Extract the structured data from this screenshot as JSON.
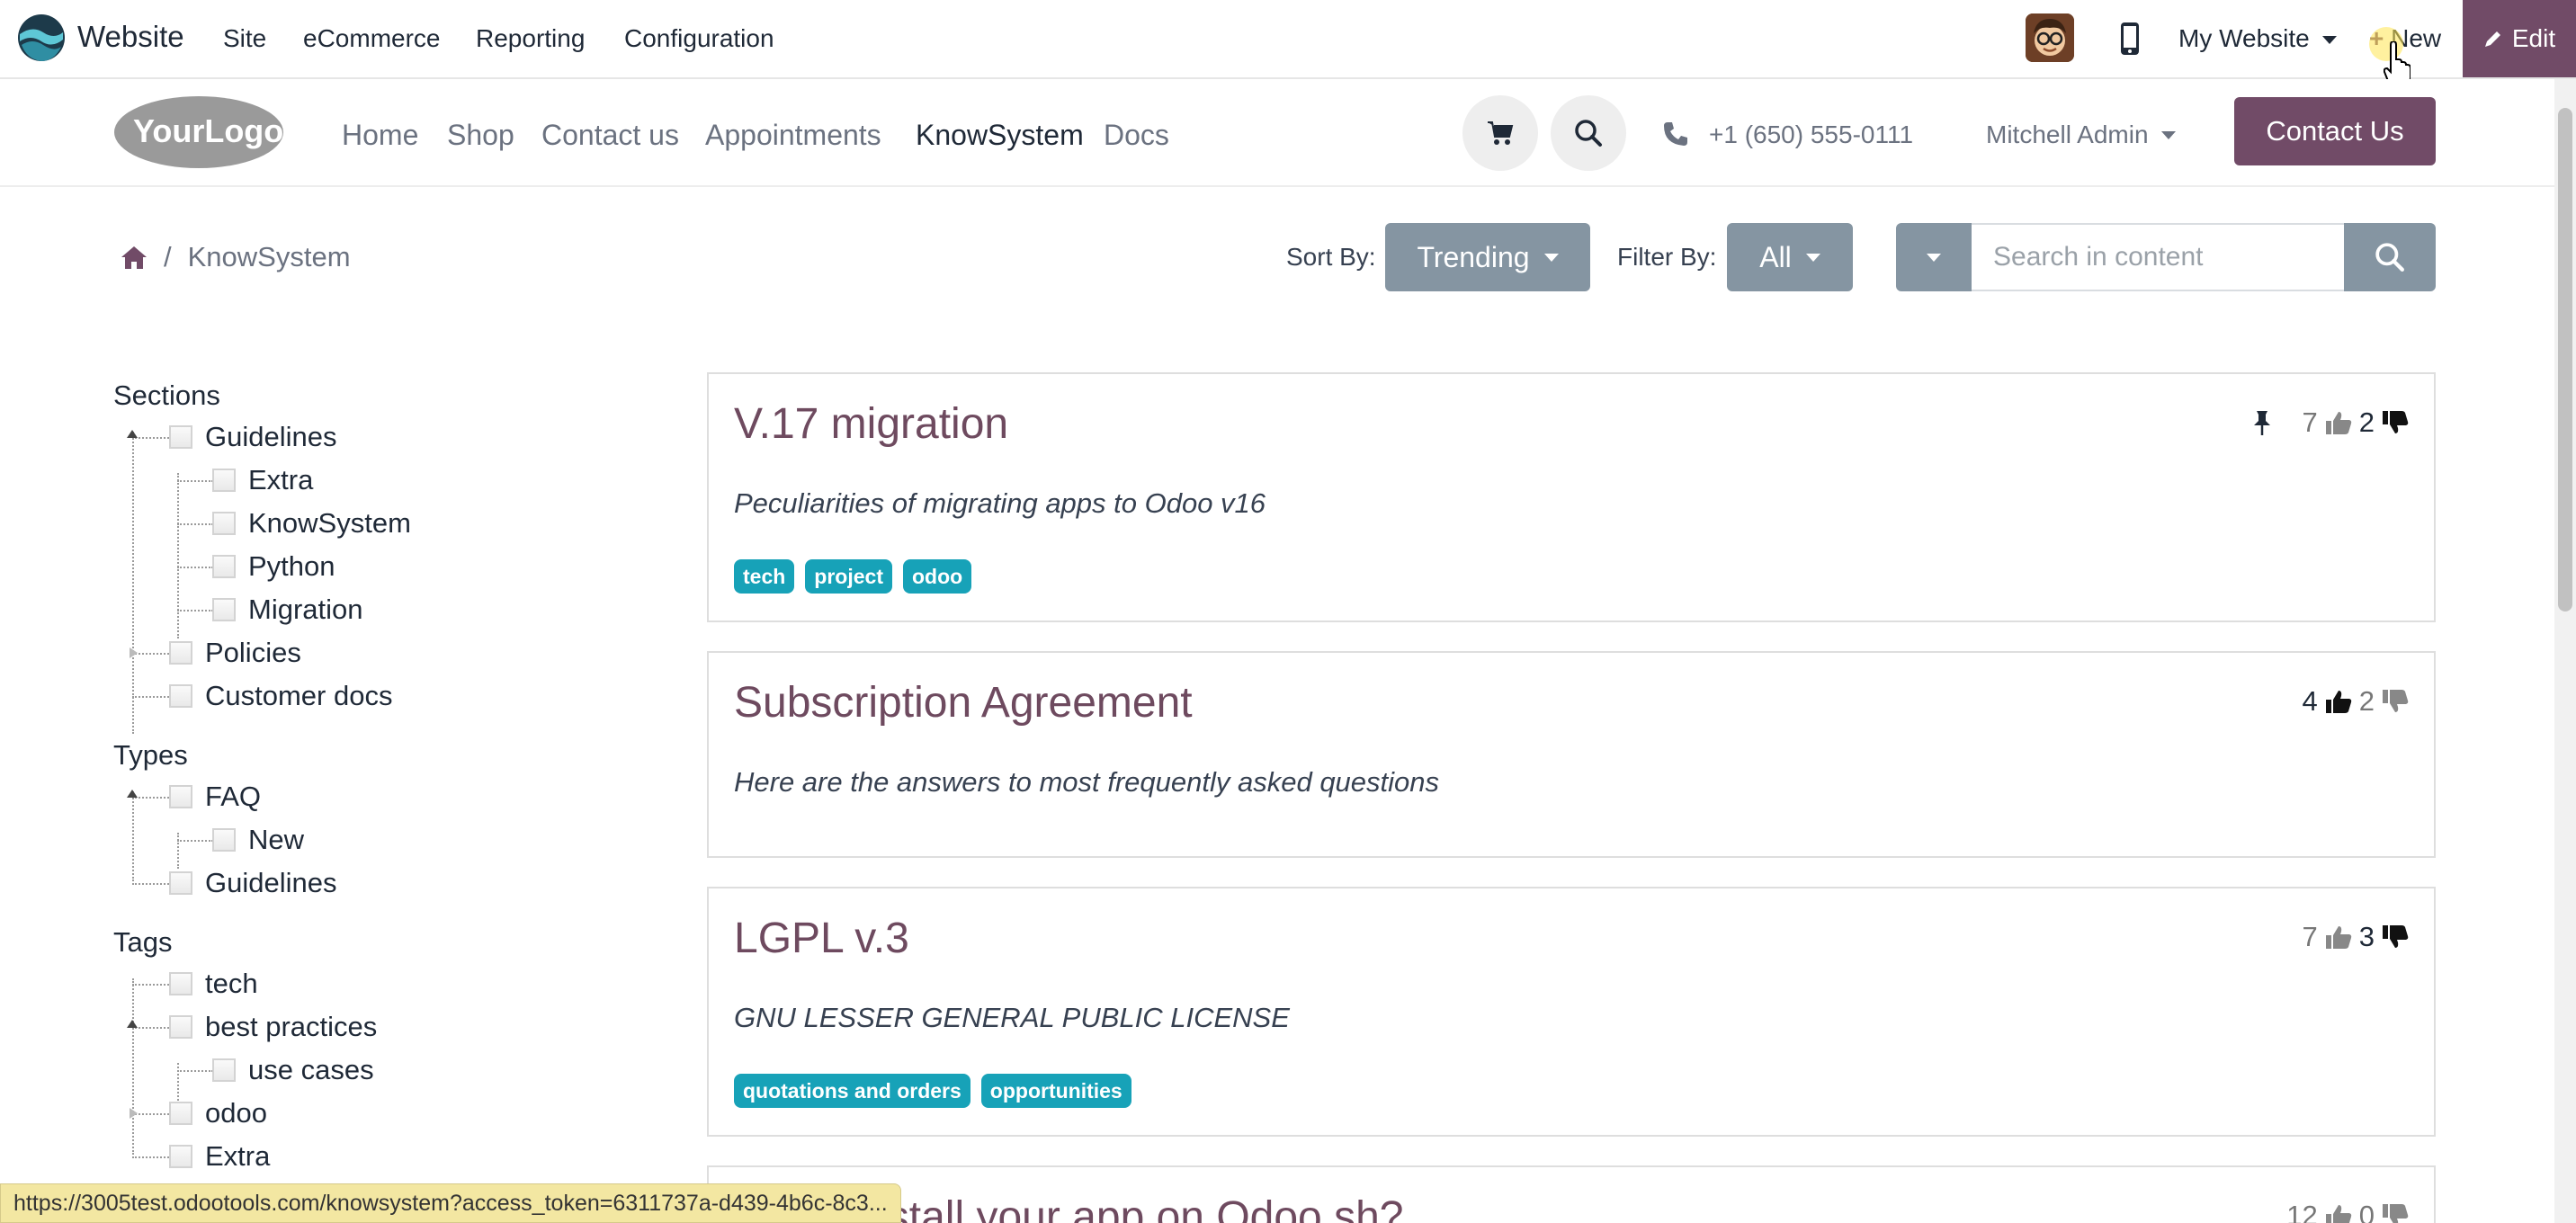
{
  "adminbar": {
    "app_name": "Website",
    "menus": [
      "Site",
      "eCommerce",
      "Reporting",
      "Configuration"
    ],
    "website_selector": "My Website",
    "new_label": "New",
    "edit_label": "Edit"
  },
  "header": {
    "logo_text": "YourLogo",
    "nav": [
      "Home",
      "Shop",
      "Contact us",
      "Appointments",
      "KnowSystem",
      "Docs"
    ],
    "active_nav": "KnowSystem",
    "phone": "+1 (650) 555-0111",
    "user": "Mitchell Admin",
    "contact_button": "Contact Us"
  },
  "toolbar": {
    "breadcrumb": "KnowSystem",
    "sort_label": "Sort By:",
    "sort_value": "Trending",
    "filter_label": "Filter By:",
    "filter_value": "All",
    "search_placeholder": "Search in content"
  },
  "sidebar": {
    "sections_title": "Sections",
    "sections": {
      "guidelines": "Guidelines",
      "extra": "Extra",
      "knowsystem": "KnowSystem",
      "python": "Python",
      "migration": "Migration",
      "policies": "Policies",
      "customer_docs": "Customer docs"
    },
    "types_title": "Types",
    "types": {
      "faq": "FAQ",
      "new": "New",
      "guidelines": "Guidelines"
    },
    "tags_title": "Tags",
    "tags": {
      "tech": "tech",
      "best_practices": "best practices",
      "use_cases": "use cases",
      "odoo": "odoo",
      "extra": "Extra"
    }
  },
  "articles": [
    {
      "title": "V.17 migration",
      "subtitle": "Peculiarities of migrating apps to Odoo v16",
      "tags": [
        "tech",
        "project",
        "odoo"
      ],
      "likes": "7",
      "dislikes": "2"
    },
    {
      "title": "Subscription Agreement",
      "subtitle": "Here are the answers to most frequently asked questions",
      "likes": "4",
      "dislikes": "2"
    },
    {
      "title": "LGPL v.3",
      "subtitle": "GNU LESSER GENERAL PUBLIC LICENSE",
      "tags": [
        "quotations and orders",
        "opportunities"
      ],
      "likes": "7",
      "dislikes": "3"
    },
    {
      "title": "...an I install your app on Odoo.sh?",
      "likes": "12",
      "dislikes": "0"
    }
  ],
  "status_url": "https://3005test.odootools.com/knowsystem?access_token=6311737a-d439-4b6c-8c3...",
  "colors": {
    "brand": "#714b67",
    "title": "#6e4a5f",
    "tag": "#17a2b8",
    "dropdown": "#8595a2"
  }
}
